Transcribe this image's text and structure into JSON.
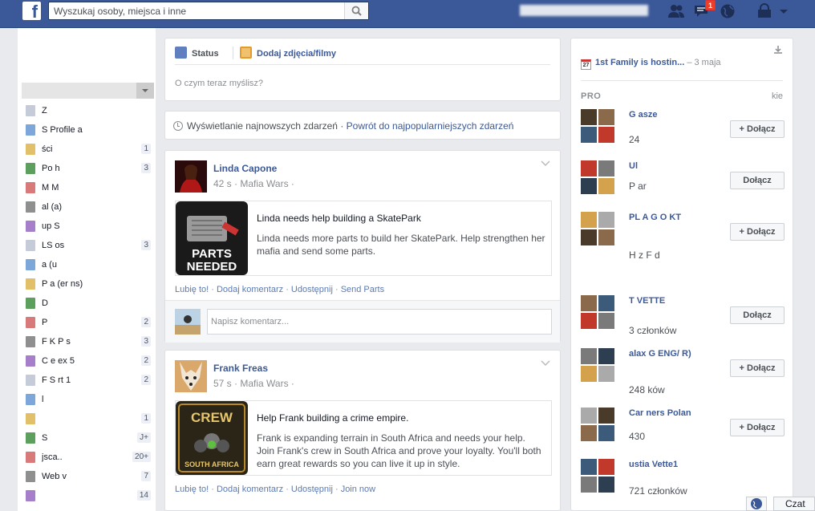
{
  "topbar": {
    "logo_letter": "f",
    "search_placeholder": "Wyszukaj osoby, miejsca i inne",
    "notifications_count": "1"
  },
  "left": {
    "items": [
      {
        "label": "Z",
        "count": ""
      },
      {
        "label": "S  Profile  a",
        "count": ""
      },
      {
        "label": "ści",
        "count": "1"
      },
      {
        "label": "Po  h",
        "count": "3"
      },
      {
        "label": "M  M",
        "count": ""
      },
      {
        "label": "al  (a)",
        "count": ""
      },
      {
        "label": "up  S",
        "count": ""
      },
      {
        "label": "LS  os",
        "count": "3"
      },
      {
        "label": "a  (u",
        "count": ""
      },
      {
        "label": "P  a  (er  ns)",
        "count": ""
      },
      {
        "label": "D",
        "count": ""
      },
      {
        "label": "P",
        "count": "2"
      },
      {
        "label": "F  K  P  s",
        "count": "3"
      },
      {
        "label": "C  e  ex  5",
        "count": "2"
      },
      {
        "label": "F  S  rt  1",
        "count": "2"
      },
      {
        "label": "l",
        "count": ""
      },
      {
        "label": "",
        "count": "1"
      },
      {
        "label": "S",
        "count": "J+"
      },
      {
        "label": "jsca..",
        "count": "20+"
      },
      {
        "label": "Web  v",
        "count": "7"
      },
      {
        "label": "",
        "count": "14"
      }
    ]
  },
  "composer": {
    "tab_status": "Status",
    "tab_photo": "Dodaj zdjęcia/filmy",
    "prompt": "O czym teraz myślisz?"
  },
  "sortbar": {
    "current": "Wyświetlanie najnowszych zdarzeń",
    "separator": " · ",
    "link": "Powrót do najpopularniejszych zdarzeń"
  },
  "posts": [
    {
      "name": "Linda Capone",
      "meta": "42 s · Mafia Wars ·",
      "title": "Linda needs help building a SkatePark",
      "desc": "Linda needs more parts to build her SkatePark. Help strengthen her mafia and send some parts.",
      "thumb_text_1": "PARTS",
      "thumb_text_2": "NEEDED",
      "actions": [
        "Lubię to!",
        "Dodaj komentarz",
        "Udostępnij",
        "Send Parts"
      ],
      "comment_placeholder": "Napisz komentarz..."
    },
    {
      "name": "Frank Freas",
      "meta": "57 s · Mafia Wars ·",
      "title": "Help Frank building a crime empire.",
      "desc": "Frank is expanding terrain in South Africa and needs your help. Join Frank's crew in South Africa and prove your loyalty. You'll both earn great rewards so you can live it up in style.",
      "thumb_text_1": "CREW",
      "thumb_text_2": "SOUTH AFRICA",
      "actions": [
        "Lubię to!",
        "Dodaj komentarz",
        "Udostępnij",
        "Join now"
      ]
    }
  ],
  "right": {
    "event_title": "1st Family is hostin...",
    "event_date": "– 3 maja",
    "calendar_day": "27",
    "section_title": "PRO",
    "section_right": "kie",
    "groups": [
      {
        "name": "G  asze",
        "sub": "24",
        "button": "+ Dołącz"
      },
      {
        "name": "Ul",
        "sub": "P  ar",
        "button": "Dołącz"
      },
      {
        "name": "PL  A G  O  KT",
        "sub": "H  z F  d",
        "button": "+ Dołącz"
      },
      {
        "name": "T  VETTE",
        "sub": "3  członków",
        "button": "Dołącz"
      },
      {
        "name": "alax G  ENG/  R)",
        "sub": "248  ków",
        "button": "+ Dołącz"
      },
      {
        "name": "Car  ners Polan",
        "sub": "430",
        "button": "+ Dołącz"
      },
      {
        "name": "ustia  Vette1",
        "sub": "721 członków",
        "button": ""
      }
    ]
  },
  "chat": {
    "label": "Czat"
  },
  "colors": {
    "brand": "#3b5998",
    "link": "#3b5998",
    "badge": "#f03d25"
  },
  "icons": [
    "facebook-logo-icon",
    "search-icon",
    "friends-icon",
    "messages-icon",
    "globe-icon",
    "settings-icon",
    "pencil-icon",
    "photo-icon",
    "clock-icon",
    "chevron-down-icon",
    "download-icon",
    "calendar-icon"
  ]
}
